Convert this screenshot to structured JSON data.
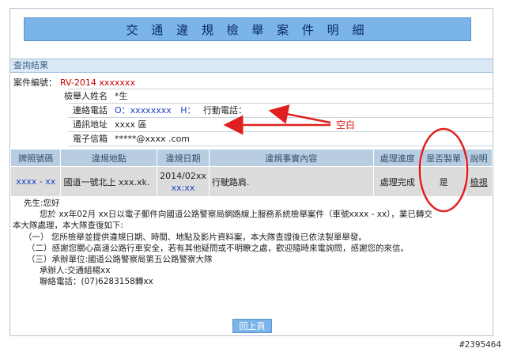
{
  "page": {
    "title": "交 通 違 規 檢 舉 案 件 明 細",
    "section_title": "查詢結果",
    "back_button": "回上頁",
    "stamp": "#2395464"
  },
  "case": {
    "number_label": "案件編號：",
    "number_value": "RV-2014 xxxxxxx"
  },
  "reporter": {
    "name_label": "檢舉人姓名",
    "name_value": "*生",
    "phone_label": "連絡電話",
    "phone_value_o": "O：xxxxxxxx",
    "phone_value_h": "H：",
    "mobile_label": "行動電話：",
    "address_label": "通訊地址",
    "address_value": "xxxx 區",
    "email_label": "電子信箱",
    "email_value": "*****@xxxx .com"
  },
  "annotation": {
    "label": "空白",
    "color": "#e02020"
  },
  "table": {
    "headers": [
      "牌照號碼",
      "違規地點",
      "違規日期",
      "違規事實內容",
      "處理進度",
      "是否製單",
      "說明"
    ],
    "row": {
      "plate": "xxxx - xx",
      "location": "國道一號北上 xxx.xk.",
      "date_line1": "2014/02xx",
      "date_line2": "xx:xx",
      "fact": "行駛路肩.",
      "status": "處理完成",
      "ticketed": "是",
      "detail_link": "檢視"
    }
  },
  "letter": {
    "lines": [
      "先生:您好",
      "您於 xx年02月 xx日以電子郵件向國道公路警察局網路線上服務系統檢舉案件（車號xxxx - xx），業已轉交",
      "本大隊處理，本大隊查復如下:",
      "（一）  您所檢舉並提供違規日期、時間、地點及影片資料案，本大隊查證後已依法製單舉發。",
      "（二）感謝您關心高速公路行車安全，若有其他疑問或不明瞭之處，歡迎隨時來電詢問，感謝您的來信。",
      "（三）承辦單位:國道公路警察局第五公路警察大隊",
      "承辦人:交通組楊xx",
      "聯絡電話：(07)6283158轉xx"
    ]
  }
}
